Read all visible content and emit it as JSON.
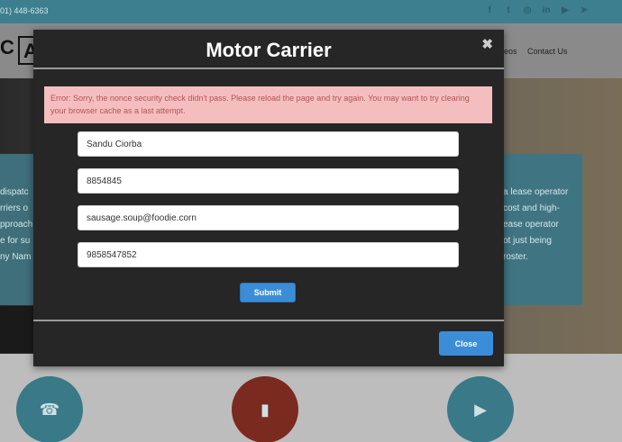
{
  "background": {
    "topbar": {
      "phone": "01) 448-6363"
    },
    "social_icons": [
      "facebook-icon",
      "twitter-icon",
      "instagram-icon",
      "linkedin-icon",
      "youtube-icon",
      "telegram-icon"
    ],
    "nav": {
      "fragment": "eos",
      "contact": "Contact Us"
    },
    "hero_left_lines": [
      "dispatc",
      "rriers o",
      "pproach",
      "e for su",
      "ny Nam"
    ],
    "hero_right_lines": [
      "a lease operator",
      "cost and high-",
      "ease operator",
      "ot just being",
      "roster."
    ]
  },
  "modal": {
    "title": "Motor Carrier",
    "close_symbol": "✖",
    "error": "Error: Sorry, the nonce security check didn't pass. Please reload the page and try again. You may want to try clearing your browser cache as a last attempt.",
    "fields": [
      {
        "name": "name-field",
        "value": "Sandu Ciorba"
      },
      {
        "name": "phone-field",
        "value": "8854845"
      },
      {
        "name": "email-field",
        "value": "sausage.soup@foodie.corn"
      },
      {
        "name": "mobile-field",
        "value": "9858547852"
      }
    ],
    "submit_label": "Submit",
    "close_label": "Close"
  },
  "colors": {
    "accent": "#3c8dd8",
    "error_bg": "#f5bebe",
    "error_text": "#b35454",
    "modal_bg": "#262626"
  }
}
